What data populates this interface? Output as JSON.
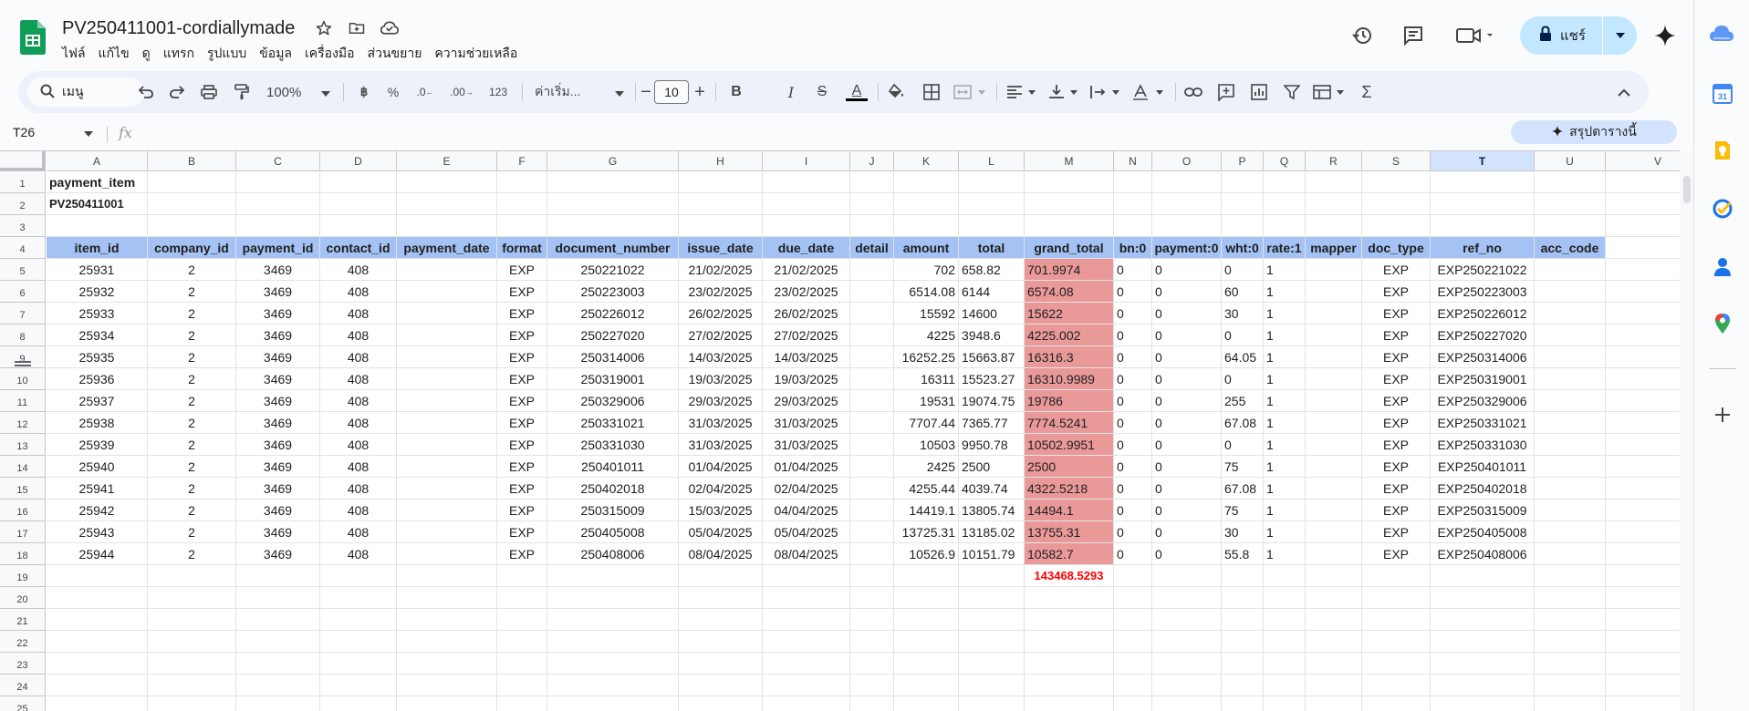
{
  "doc": {
    "title": "PV250411001-cordiallymade",
    "menu": [
      "ไฟล์",
      "แก้ไข",
      "ดู",
      "แทรก",
      "รูปแบบ",
      "ข้อมูล",
      "เครื่องมือ",
      "ส่วนขยาย",
      "ความช่วยเหลือ"
    ],
    "share_label": "แชร์"
  },
  "toolbar": {
    "search_label": "เมนู",
    "zoom": "100%",
    "currency": "฿",
    "percent": "%",
    "dec_decrease": ".0",
    "dec_increase": ".00",
    "format_123": "123",
    "font_name": "ค่าเริ่ม...",
    "font_size": "10",
    "bold": "B",
    "italic": "I",
    "strike": "S",
    "text_color": "A",
    "sum": "Σ"
  },
  "formula_bar": {
    "cell_ref": "T26",
    "fx": "fx",
    "summarize_label": "สรุปตารางนี้"
  },
  "grid": {
    "columns": [
      "A",
      "B",
      "C",
      "D",
      "E",
      "F",
      "G",
      "H",
      "I",
      "J",
      "K",
      "L",
      "M",
      "N",
      "O",
      "P",
      "Q",
      "R",
      "S",
      "T",
      "U",
      "V"
    ],
    "selected_column": "T",
    "row_numbers": [
      "1",
      "2",
      "3",
      "4",
      "5",
      "6",
      "7",
      "8",
      "9",
      "10",
      "11",
      "12",
      "13",
      "14",
      "15",
      "16",
      "17",
      "18",
      "19",
      "20",
      "21",
      "22",
      "23",
      "24",
      "25"
    ],
    "sheet_title": "payment_item",
    "sheet_subtitle": "PV250411001",
    "headers": [
      "item_id",
      "company_id",
      "payment_id",
      "contact_id",
      "payment_date",
      "format",
      "document_number",
      "issue_date",
      "due_date",
      "detail",
      "amount",
      "total",
      "grand_total",
      "bn:0",
      "payment:0",
      "wht:0",
      "rate:1",
      "mapper",
      "doc_type",
      "ref_no",
      "acc_code"
    ],
    "rows": [
      [
        "25931",
        "2",
        "3469",
        "408",
        "",
        "EXP",
        "250221022",
        "21/02/2025",
        "21/02/2025",
        "",
        "702",
        "658.82",
        "701.9974",
        "0",
        "0",
        "0",
        "1",
        "",
        "EXP",
        "EXP250221022",
        ""
      ],
      [
        "25932",
        "2",
        "3469",
        "408",
        "",
        "EXP",
        "250223003",
        "23/02/2025",
        "23/02/2025",
        "",
        "6514.08",
        "6144",
        "6574.08",
        "0",
        "0",
        "60",
        "1",
        "",
        "EXP",
        "EXP250223003",
        ""
      ],
      [
        "25933",
        "2",
        "3469",
        "408",
        "",
        "EXP",
        "250226012",
        "26/02/2025",
        "26/02/2025",
        "",
        "15592",
        "14600",
        "15622",
        "0",
        "0",
        "30",
        "1",
        "",
        "EXP",
        "EXP250226012",
        ""
      ],
      [
        "25934",
        "2",
        "3469",
        "408",
        "",
        "EXP",
        "250227020",
        "27/02/2025",
        "27/02/2025",
        "",
        "4225",
        "3948.6",
        "4225.002",
        "0",
        "0",
        "0",
        "1",
        "",
        "EXP",
        "EXP250227020",
        ""
      ],
      [
        "25935",
        "2",
        "3469",
        "408",
        "",
        "EXP",
        "250314006",
        "14/03/2025",
        "14/03/2025",
        "",
        "16252.25",
        "15663.87",
        "16316.3",
        "0",
        "0",
        "64.05",
        "1",
        "",
        "EXP",
        "EXP250314006",
        ""
      ],
      [
        "25936",
        "2",
        "3469",
        "408",
        "",
        "EXP",
        "250319001",
        "19/03/2025",
        "19/03/2025",
        "",
        "16311",
        "15523.27",
        "16310.9989",
        "0",
        "0",
        "0",
        "1",
        "",
        "EXP",
        "EXP250319001",
        ""
      ],
      [
        "25937",
        "2",
        "3469",
        "408",
        "",
        "EXP",
        "250329006",
        "29/03/2025",
        "29/03/2025",
        "",
        "19531",
        "19074.75",
        "19786",
        "0",
        "0",
        "255",
        "1",
        "",
        "EXP",
        "EXP250329006",
        ""
      ],
      [
        "25938",
        "2",
        "3469",
        "408",
        "",
        "EXP",
        "250331021",
        "31/03/2025",
        "31/03/2025",
        "",
        "7707.44",
        "7365.77",
        "7774.5241",
        "0",
        "0",
        "67.08",
        "1",
        "",
        "EXP",
        "EXP250331021",
        ""
      ],
      [
        "25939",
        "2",
        "3469",
        "408",
        "",
        "EXP",
        "250331030",
        "31/03/2025",
        "31/03/2025",
        "",
        "10503",
        "9950.78",
        "10502.9951",
        "0",
        "0",
        "0",
        "1",
        "",
        "EXP",
        "EXP250331030",
        ""
      ],
      [
        "25940",
        "2",
        "3469",
        "408",
        "",
        "EXP",
        "250401011",
        "01/04/2025",
        "01/04/2025",
        "",
        "2425",
        "2500",
        "2500",
        "0",
        "0",
        "75",
        "1",
        "",
        "EXP",
        "EXP250401011",
        ""
      ],
      [
        "25941",
        "2",
        "3469",
        "408",
        "",
        "EXP",
        "250402018",
        "02/04/2025",
        "02/04/2025",
        "",
        "4255.44",
        "4039.74",
        "4322.5218",
        "0",
        "0",
        "67.08",
        "1",
        "",
        "EXP",
        "EXP250402018",
        ""
      ],
      [
        "25942",
        "2",
        "3469",
        "408",
        "",
        "EXP",
        "250315009",
        "15/03/2025",
        "04/04/2025",
        "",
        "14419.1",
        "13805.74",
        "14494.1",
        "0",
        "0",
        "75",
        "1",
        "",
        "EXP",
        "EXP250315009",
        ""
      ],
      [
        "25943",
        "2",
        "3469",
        "408",
        "",
        "EXP",
        "250405008",
        "05/04/2025",
        "05/04/2025",
        "",
        "13725.31",
        "13185.02",
        "13755.31",
        "0",
        "0",
        "30",
        "1",
        "",
        "EXP",
        "EXP250405008",
        ""
      ],
      [
        "25944",
        "2",
        "3469",
        "408",
        "",
        "EXP",
        "250408006",
        "08/04/2025",
        "08/04/2025",
        "",
        "10526.9",
        "10151.79",
        "10582.7",
        "0",
        "0",
        "55.8",
        "1",
        "",
        "EXP",
        "EXP250408006",
        ""
      ]
    ],
    "grand_total_sum": "143468.5293"
  },
  "colors": {
    "header_fill": "#a4c2f4",
    "grand_total_fill": "#ea9999",
    "sum_text": "#ff0000"
  },
  "icons": [
    "sheets-logo",
    "star-icon",
    "folder-icon",
    "cloud-icon",
    "history-icon",
    "comment-icon",
    "meet-icon",
    "lock-icon",
    "gemini-icon",
    "cloud-account-icon",
    "calendar-icon",
    "keep-icon",
    "tasks-icon",
    "contacts-icon",
    "maps-icon",
    "add-icon"
  ]
}
